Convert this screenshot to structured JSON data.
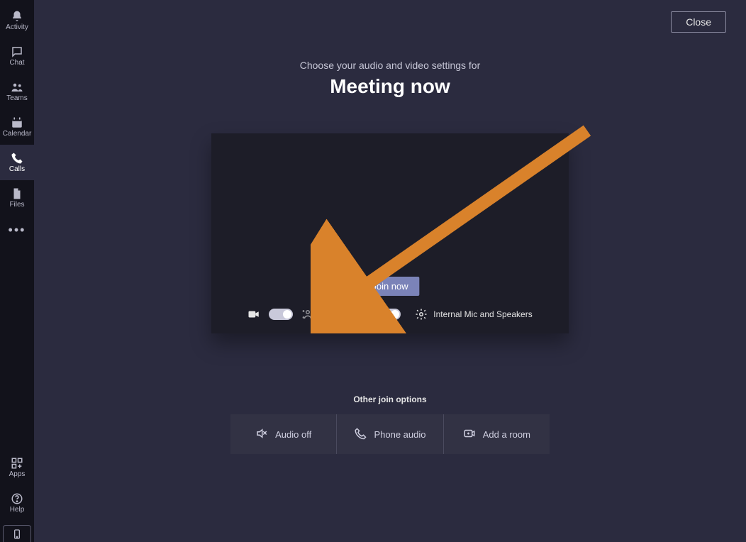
{
  "rail": {
    "items": [
      {
        "label": "Activity",
        "icon": "bell"
      },
      {
        "label": "Chat",
        "icon": "chat"
      },
      {
        "label": "Teams",
        "icon": "teams"
      },
      {
        "label": "Calendar",
        "icon": "calendar"
      },
      {
        "label": "Calls",
        "icon": "phone",
        "selected": true
      },
      {
        "label": "Files",
        "icon": "file"
      }
    ],
    "bottom": [
      {
        "label": "Apps",
        "icon": "apps"
      },
      {
        "label": "Help",
        "icon": "help"
      }
    ]
  },
  "close_label": "Close",
  "header": {
    "subtitle": "Choose your audio and video settings for",
    "title": "Meeting now"
  },
  "preview": {
    "join_label": "Join now",
    "camera_on": true,
    "blur_on": false,
    "mic_on": true,
    "device_label": "Internal Mic and Speakers"
  },
  "other_options": {
    "title": "Other join options",
    "items": [
      {
        "label": "Audio off",
        "icon": "audio-off"
      },
      {
        "label": "Phone audio",
        "icon": "phone-audio"
      },
      {
        "label": "Add a room",
        "icon": "add-room"
      }
    ]
  },
  "annotation": {
    "type": "arrow",
    "color": "#d9822b"
  }
}
